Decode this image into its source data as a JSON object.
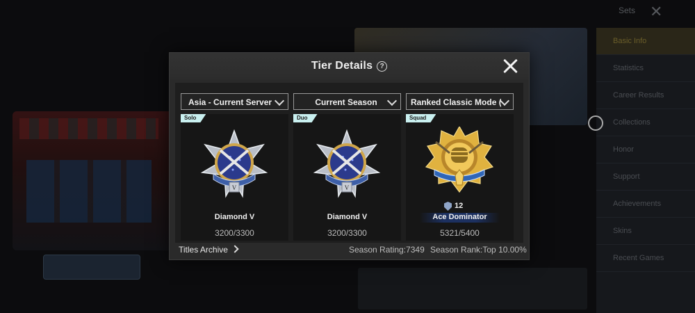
{
  "background": {
    "settings_label": "Sets",
    "panel_rows": [
      "Basic Info",
      "Statistics",
      "Career Results",
      "Collections",
      "Honor",
      "Support",
      "Achievements",
      "Skins",
      "Recent Games"
    ]
  },
  "dialog": {
    "title": "Tier Details",
    "filters": {
      "server": "Asia - Current Server",
      "season": "Current Season",
      "mode": "Ranked Classic Mode (TPP)"
    },
    "cards": [
      {
        "mode": "Solo",
        "tier": "Diamond V",
        "points": "3200/3300",
        "badge": "diamond"
      },
      {
        "mode": "Duo",
        "tier": "Diamond V",
        "points": "3200/3300",
        "badge": "diamond"
      },
      {
        "mode": "Squad",
        "tier": "Ace Dominator",
        "points": "5321/5400",
        "badge": "ace",
        "ace_count": "12"
      }
    ],
    "footer": {
      "archive": "Titles Archive",
      "season_rating": "Season Rating:7349",
      "season_rank": "Season Rank:Top 10.00%"
    }
  },
  "colors": {
    "accent": "#33b7d4",
    "tag": "#c9f0f0",
    "gold": "#d8a93a",
    "diamond_blue": "#2b3a8c"
  }
}
